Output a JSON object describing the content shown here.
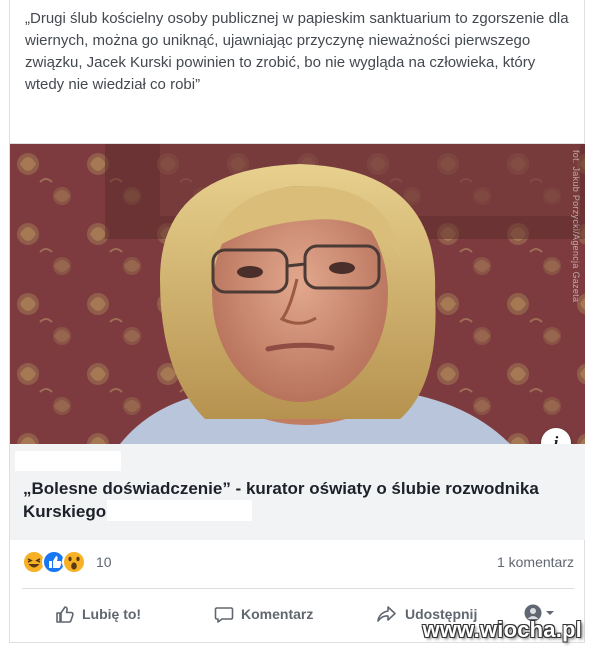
{
  "post": {
    "text": "„Drugi ślub kościelny osoby publicznej w papieskim sanktuarium to zgorszenie dla wiernych, można go uniknąć, ujawniając przyczynę nieważności pierwszego związku, Jacek Kurski powinien to zrobić, bo nie wygląda na człowieka, który wtedy nie wiedział co robi”"
  },
  "link_preview": {
    "photo_credit": "fot. Jakub Porzycki/Agencja Gazeta",
    "info_label": "i",
    "title": "„Bolesne doświadczenie” - kurator oświaty o ślubie rozwodnika Kurskiego"
  },
  "reactions": {
    "icons": [
      "haha-reaction-icon",
      "like-reaction-icon",
      "wow-reaction-icon"
    ],
    "count": "10",
    "comments": "1 komentarz"
  },
  "actions": {
    "like": "Lubię to!",
    "comment": "Komentarz",
    "share": "Udostępnij"
  },
  "watermark": "www.wiocha.pl",
  "colors": {
    "like_blue": "#1877f2",
    "haha_yellow": "#f7b125",
    "text_gray": "#606770",
    "link_bg": "#f2f3f5"
  }
}
